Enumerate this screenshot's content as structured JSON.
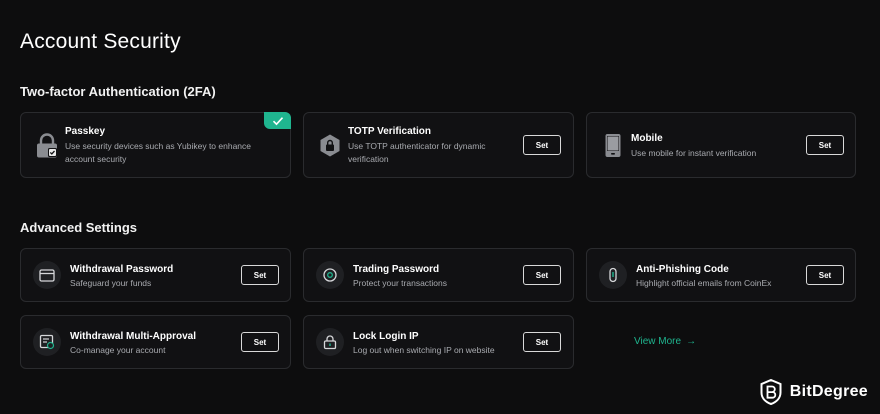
{
  "page": {
    "title": "Account Security"
  },
  "sections": {
    "two_factor": {
      "title": "Two-factor Authentication (2FA)"
    },
    "advanced": {
      "title": "Advanced Settings"
    }
  },
  "two_factor_cards": {
    "passkey": {
      "title": "Passkey",
      "desc": "Use security devices such as Yubikey to enhance account security",
      "icon": "padlock-check-icon",
      "enabled": true
    },
    "totp": {
      "title": "TOTP Verification",
      "desc": "Use TOTP authenticator for dynamic verification",
      "icon": "shield-lock-icon",
      "button": "Set"
    },
    "mobile": {
      "title": "Mobile",
      "desc": "Use mobile for instant verification",
      "icon": "mobile-phone-icon",
      "button": "Set"
    }
  },
  "advanced_cards": {
    "withdrawal_password": {
      "title": "Withdrawal Password",
      "desc": "Safeguard your funds",
      "icon": "card-icon",
      "button": "Set"
    },
    "trading_password": {
      "title": "Trading Password",
      "desc": "Protect your transactions",
      "icon": "target-icon",
      "button": "Set"
    },
    "anti_phishing": {
      "title": "Anti-Phishing Code",
      "desc": "Highlight official emails from CoinEx",
      "icon": "hook-icon",
      "button": "Set"
    },
    "multi_approval": {
      "title": "Withdrawal Multi-Approval",
      "desc": "Co-manage your account",
      "icon": "document-check-icon",
      "button": "Set"
    },
    "lock_login_ip": {
      "title": "Lock Login IP",
      "desc": "Log out when switching IP on website",
      "icon": "lock-icon",
      "button": "Set"
    }
  },
  "view_more": {
    "label": "View More",
    "arrow": "→"
  },
  "watermark": {
    "text": "BitDegree"
  },
  "colors": {
    "accent": "#1fb58f",
    "background": "#0d0d0e",
    "card_border": "#2a2b2e"
  }
}
